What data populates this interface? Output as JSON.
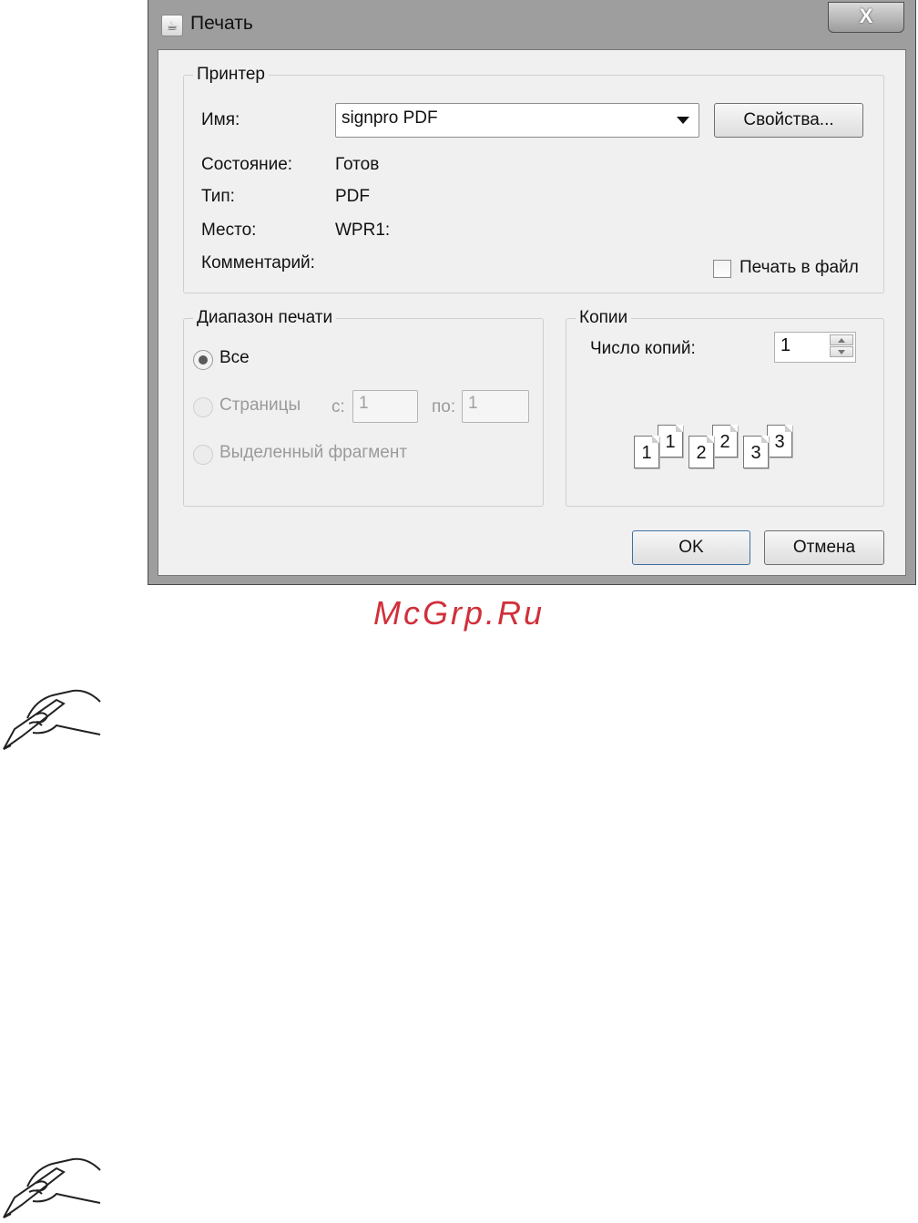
{
  "dialog": {
    "title": "Печать",
    "close_symbol": "X"
  },
  "printer": {
    "legend": "Принтер",
    "name_label": "Имя:",
    "name_value": "signpro PDF",
    "properties_button": "Свойства...",
    "status_label": "Состояние:",
    "status_value": "Готов",
    "type_label": "Тип:",
    "type_value": "PDF",
    "location_label": "Место:",
    "location_value": "WPR1:",
    "comment_label": "Комментарий:",
    "print_to_file_label": "Печать в файл"
  },
  "range": {
    "legend": "Диапазон печати",
    "all_label": "Все",
    "pages_label": "Страницы",
    "from_label": "с:",
    "from_value": "1",
    "to_label": "по:",
    "to_value": "1",
    "selection_label": "Выделенный фрагмент"
  },
  "copies": {
    "legend": "Копии",
    "count_label": "Число копий:",
    "count_value": "1",
    "collate_pages": [
      "1",
      "1",
      "2",
      "2",
      "3",
      "3"
    ]
  },
  "buttons": {
    "ok": "OK",
    "cancel": "Отмена"
  },
  "watermark": "McGrp.Ru",
  "icons": {
    "title": "java-cup-icon",
    "note": "hand-writing-icon"
  }
}
